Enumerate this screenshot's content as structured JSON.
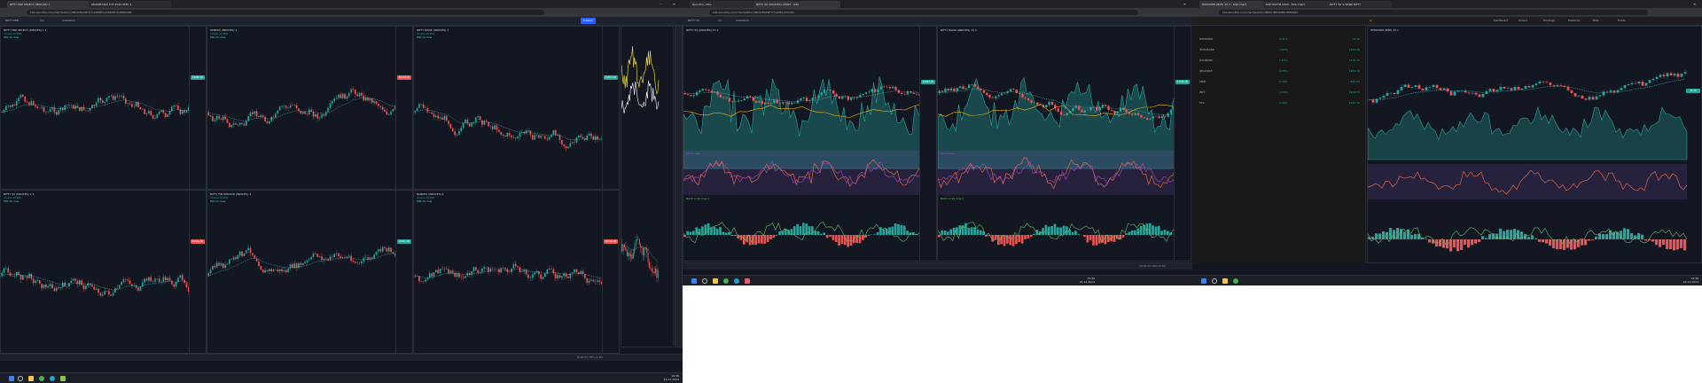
{
  "screen1": {
    "tabs": [
      "NIFTY MID SELECT (MIDCAP) 1",
      "ADANIE NOV FUT 2024 INTO 2"
    ],
    "url": "kite.zerodha.com/chart/ext/tvc/INDICES/NIFTY%20MID%20SELECT/288009#",
    "toolbar": {
      "symbol": "NIFTY MID",
      "interval": "1m",
      "indicators": "Indicators",
      "publish": "Publish"
    },
    "panes": [
      {
        "label": "NIFTY MID SELECT (INDICES) 1 1",
        "ma": "Volume 20 SMA",
        "ema": "EMA 20 close",
        "tag": "12896.00"
      },
      {
        "label": "SENSEX (INDICES) 1",
        "ma": "Volume 20 SMA",
        "ema": "EMA 20 close",
        "tag": "80148.00"
      },
      {
        "label": "NIFTY BANK (INDICES) 1",
        "ma": "Volume 20 SMA",
        "ema": "EMA 20 close",
        "tag": "51872.00"
      },
      {
        "label": "NIFTY 50 (INDICES) 1 1",
        "ma": "Volume 20 SMA",
        "ema": "EMA 20 close",
        "tag": "24366.00"
      },
      {
        "label": "NIFTY FIN SERVICE (INDICES) 1",
        "ma": "Volume 20 SMA",
        "ema": "EMA 20 close",
        "tag": "23821.00"
      },
      {
        "label": "BANKEX (INDICES) 1",
        "ma": "Volume 20 SMA",
        "ema": "EMA 20 close",
        "tag": "58740.00"
      }
    ],
    "status": "19:36:53 (UTC+5:30)",
    "clock": {
      "time": "19:36",
      "date": "22-11-2024"
    }
  },
  "screen2": {
    "tabs": [
      "Zerodha - Kite",
      "NIFTY 50 (INDICES) 15000 - Kite"
    ],
    "url": "kite.zerodha.com/chart/ext/tvc/INDICES/NIFTY%2050/256265",
    "toolbar": {
      "symbol": "NIFTY 50",
      "interval": "15",
      "indicators": "Indicators"
    },
    "panes": [
      {
        "label": "NIFTY 50 (INDICES) 15 1",
        "tag": "23907.25"
      },
      {
        "label": "NIFTY BANK (INDICES) 15 1",
        "tag": "51135.40"
      }
    ],
    "rsi": "RSI 14 close",
    "macd": "MACD 12 26 close 9",
    "status": "19:36:53 (UTC+5:30)",
    "clock": {
      "time": "19:36",
      "date": "22-11-2024"
    }
  },
  "screen3": {
    "tabs": [
      "HPPOWER (BSE) 15.7 - Kite Chart",
      "BSE/HDFCB 0000 - Kite Chart",
      "NIFTY 50 & BANK NIFTY"
    ],
    "url": "kite.zerodha.com/chart/web/tvc/BSE/HPPOWER/3883265",
    "nav": [
      "Dashboard",
      "Orders",
      "Holdings",
      "Positions",
      "Bids",
      "Funds"
    ],
    "watchlist": [
      {
        "name": "HPPOWER",
        "ltp": "15.70",
        "chg": "2.01%"
      },
      {
        "name": "HDFCBANK",
        "ltp": "1744.20",
        "chg": "1.67%"
      },
      {
        "name": "ICICIBANK",
        "ltp": "1276.75",
        "chg": "1.15%"
      },
      {
        "name": "RELIANCE",
        "ltp": "1263.15",
        "chg": "0.95%"
      },
      {
        "name": "SBIN",
        "ltp": "834.05",
        "chg": "2.40%"
      },
      {
        "name": "INFY",
        "ltp": "1929.55",
        "chg": "1.53%"
      },
      {
        "name": "TCS",
        "ltp": "4295.30",
        "chg": "1.04%"
      }
    ],
    "chart_label": "HPPOWER (BSE) 15 1",
    "tag": "15.70",
    "clock": {
      "time": "19:36",
      "date": "22-11-2024"
    }
  },
  "colors": {
    "up": "#26a69a",
    "down": "#ef5350",
    "accent": "#2962ff",
    "ema": "#ffb300"
  }
}
